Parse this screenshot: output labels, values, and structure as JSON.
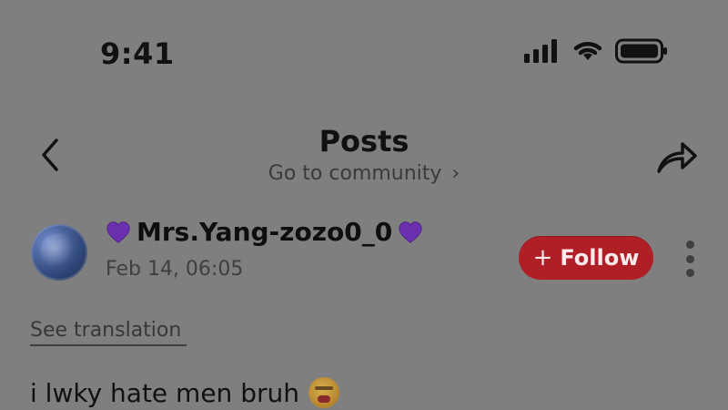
{
  "status_bar": {
    "time": "9:41",
    "icons": [
      "signal-icon",
      "wifi-icon",
      "battery-icon"
    ]
  },
  "header": {
    "title": "Posts",
    "subtitle": "Go to community",
    "subtitle_chevron": "›",
    "back_icon": "chevron-left-icon",
    "share_icon": "share-icon"
  },
  "post": {
    "author": {
      "name": "Mrs.Yang-zozo0_0",
      "name_prefix_emoji": "purple-heart",
      "name_suffix_emoji": "purple-heart",
      "avatar_icon": "user-avatar-image"
    },
    "timestamp": "Feb 14, 06:05",
    "follow": {
      "label": "Follow",
      "prefix": "+"
    },
    "translation_label": "See translation",
    "text": "i lwky hate men bruh",
    "text_emoji": "angry-face"
  },
  "colors": {
    "background": "#7f7f7f",
    "follow_button": "#b01e26",
    "heart": "#6b2fb0"
  }
}
